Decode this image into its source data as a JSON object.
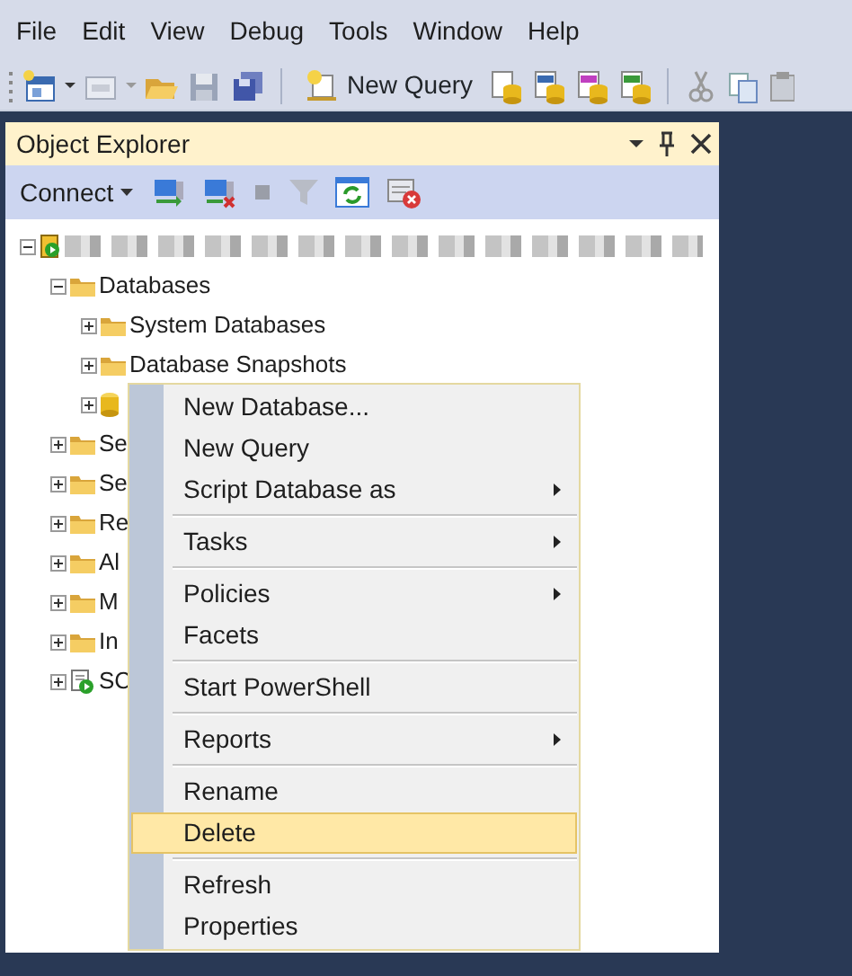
{
  "menu_bar": [
    {
      "label": "File"
    },
    {
      "label": "Edit"
    },
    {
      "label": "View"
    },
    {
      "label": "Debug"
    },
    {
      "label": "Tools"
    },
    {
      "label": "Window"
    },
    {
      "label": "Help"
    }
  ],
  "toolbar": {
    "new_query_label": "New Query"
  },
  "object_explorer": {
    "title": "Object Explorer",
    "connect_label": "Connect",
    "tree": [
      {
        "kind": "server",
        "expanded": true,
        "children": [
          {
            "kind": "folder",
            "label": "Databases",
            "expanded": true,
            "children": [
              {
                "kind": "folder",
                "label": "System Databases",
                "expanded": false
              },
              {
                "kind": "folder",
                "label": "Database Snapshots",
                "expanded": false
              },
              {
                "kind": "database",
                "expanded": false
              }
            ]
          },
          {
            "kind": "folder",
            "label": "Se",
            "expanded": false
          },
          {
            "kind": "folder",
            "label": "Se",
            "expanded": false
          },
          {
            "kind": "folder",
            "label": "Re",
            "expanded": false
          },
          {
            "kind": "folder",
            "label": "Al",
            "expanded": false
          },
          {
            "kind": "folder",
            "label": "M",
            "expanded": false
          },
          {
            "kind": "folder",
            "label": "In",
            "expanded": false
          },
          {
            "kind": "agent",
            "label": "SC",
            "expanded": false
          }
        ]
      }
    ]
  },
  "context_menu": {
    "groups": [
      [
        {
          "label": "New Database...",
          "submenu": false,
          "selected": false
        },
        {
          "label": "New Query",
          "submenu": false,
          "selected": false
        },
        {
          "label": "Script Database as",
          "submenu": true,
          "selected": false
        }
      ],
      [
        {
          "label": "Tasks",
          "submenu": true,
          "selected": false
        }
      ],
      [
        {
          "label": "Policies",
          "submenu": true,
          "selected": false
        },
        {
          "label": "Facets",
          "submenu": false,
          "selected": false
        }
      ],
      [
        {
          "label": "Start PowerShell",
          "submenu": false,
          "selected": false
        }
      ],
      [
        {
          "label": "Reports",
          "submenu": true,
          "selected": false
        }
      ],
      [
        {
          "label": "Rename",
          "submenu": false,
          "selected": false
        },
        {
          "label": "Delete",
          "submenu": false,
          "selected": true
        }
      ],
      [
        {
          "label": "Refresh",
          "submenu": false,
          "selected": false
        },
        {
          "label": "Properties",
          "submenu": false,
          "selected": false
        }
      ]
    ]
  }
}
